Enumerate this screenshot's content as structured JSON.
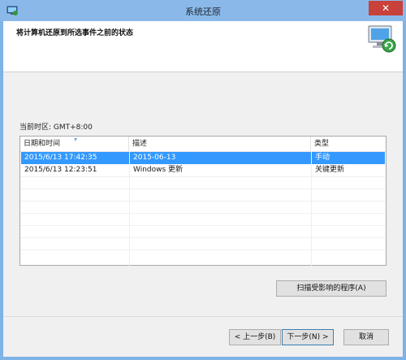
{
  "window": {
    "title": "系统还原",
    "close_glyph": "✕"
  },
  "header": {
    "title": "将计算机还原到所选事件之前的状态"
  },
  "timezone": {
    "text": "当前时区: GMT+8:00"
  },
  "table": {
    "columns": [
      "日期和时间",
      "描述",
      "类型"
    ],
    "sort_indicator": "▾",
    "rows": [
      {
        "date": "2015/6/13 17:42:35",
        "description": "2015-06-13",
        "type": "手动",
        "selected": true
      },
      {
        "date": "2015/6/13 12:23:51",
        "description": "Windows 更新",
        "type": "关键更新",
        "selected": false
      }
    ]
  },
  "buttons": {
    "scan": "扫描受影响的程序(A)",
    "back": "< 上一步(B)",
    "next": "下一步(N) >",
    "cancel": "取消"
  },
  "colors": {
    "accent": "#3399ff",
    "titlebar": "#8ab9e9",
    "close": "#c8413a"
  }
}
